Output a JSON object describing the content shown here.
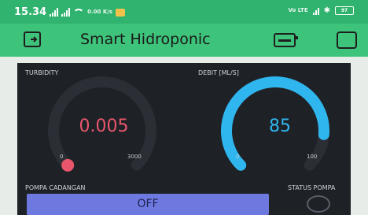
{
  "status_bar": {
    "time": "15.34",
    "left_icons": [
      "signal-icon",
      "signal-icon",
      "wifi-icon",
      "network-speed-icon",
      "app-notification-icon"
    ],
    "net_speed": "0.00 K/s",
    "right_icons": [
      "volte-icon",
      "signal-strength-icon",
      "bluetooth-icon",
      "battery-icon"
    ],
    "volte_label": "Vo LTE",
    "battery_label": "97"
  },
  "app_bar": {
    "title": "Smart Hidroponic",
    "left_icon": "exit-icon",
    "right_icons": [
      "device-icon",
      "fullscreen-icon"
    ]
  },
  "widgets": {
    "turbidity": {
      "label": "TURBIDITY",
      "value": "0.005",
      "min": "0",
      "max": "3000",
      "fill_fraction": 0.0
    },
    "debit": {
      "label": "DEBIT [ML/S]",
      "value": "85",
      "min": "0",
      "max": "100",
      "fill_fraction": 0.85
    },
    "pompa_cadangan": {
      "label": "POMPA CADANGAN",
      "button_label": "OFF"
    },
    "status_pompa": {
      "label": "STATUS POMPA",
      "state": "off"
    }
  },
  "colors": {
    "status_bar": "#2fb36e",
    "app_bar": "#3ec37a",
    "panel": "#1e2227",
    "turbidity_accent": "#e8566b",
    "debit_accent": "#2fb6ee",
    "button": "#6e79e0"
  }
}
